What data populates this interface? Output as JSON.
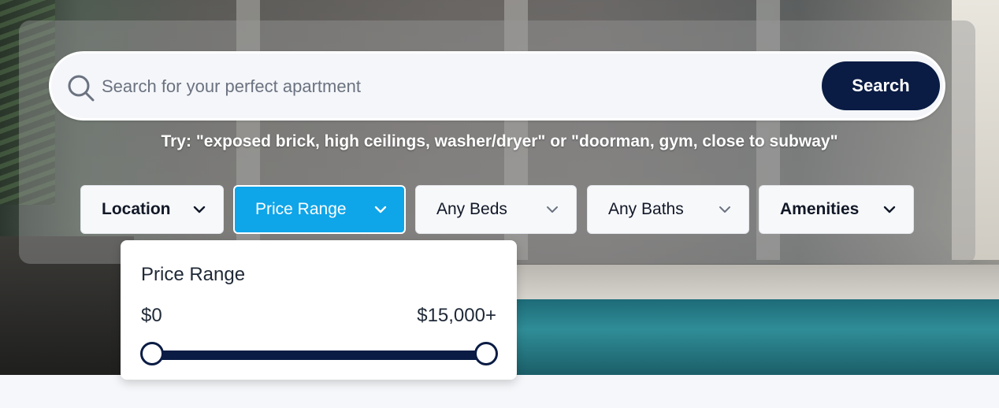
{
  "search": {
    "placeholder": "Search for your perfect apartment",
    "value": "",
    "button_label": "Search",
    "hint": "Try: \"exposed brick, high ceilings, washer/dryer\" or \"doorman, gym, close to subway\""
  },
  "filters": [
    {
      "label": "Location",
      "active": false
    },
    {
      "label": "Price Range",
      "active": true
    },
    {
      "label": "Any Beds",
      "active": false
    },
    {
      "label": "Any Baths",
      "active": false
    },
    {
      "label": "Amenities",
      "active": false
    }
  ],
  "price_dropdown": {
    "title": "Price Range",
    "min_label": "$0",
    "max_label": "$15,000+",
    "min_value_fraction": 0.0,
    "max_value_fraction": 1.0
  },
  "colors": {
    "navy": "#0a1c44",
    "active_filter": "#0ea5e9"
  },
  "icons": {
    "search": "search-icon",
    "chevron": "chevron-down-icon"
  }
}
